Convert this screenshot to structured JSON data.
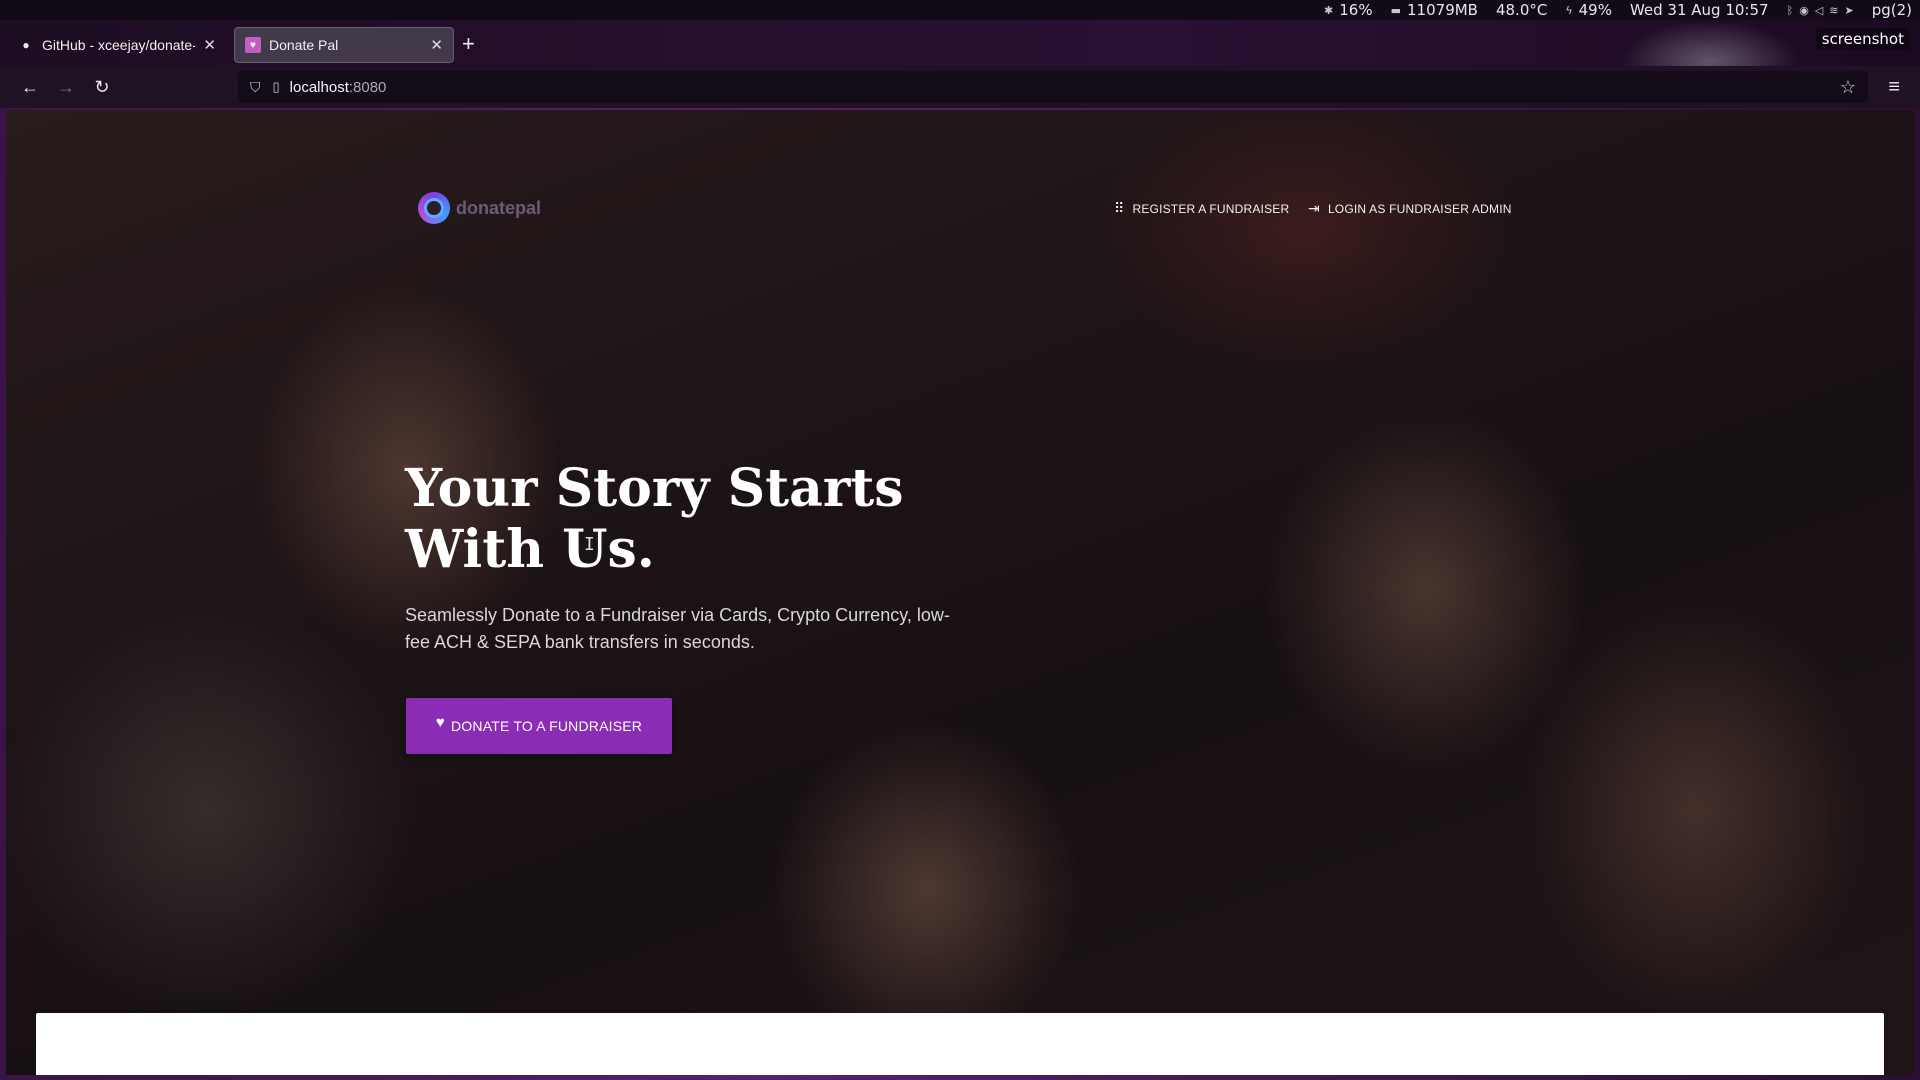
{
  "system": {
    "cpu": "16%",
    "memory": "11079MB",
    "temperature": "48.0°C",
    "battery": "49%",
    "datetime": "Wed 31 Aug 10:57",
    "workspace": "pg(2)"
  },
  "browser": {
    "tabs": [
      {
        "title": "GitHub - xceejay/donate-pa",
        "icon": "github-icon"
      },
      {
        "title": "Donate Pal",
        "icon": "donatepal-favicon"
      }
    ],
    "new_tab_label": "+",
    "screenshot_label": "screenshot",
    "url_host": "localhost",
    "url_port": ":8080"
  },
  "page": {
    "logo_text": "donatepal",
    "nav": {
      "register": "REGISTER A FUNDRAISER",
      "login": "LOGIN AS FUNDRAISER ADMIN"
    },
    "hero": {
      "title": "Your Story Starts With Us.",
      "subtitle": "Seamlessly Donate to a Fundraiser via Cards, Crypto Currency, low-fee ACH & SEPA bank transfers in seconds.",
      "cta": "DONATE TO A FUNDRAISER"
    },
    "colors": {
      "accent": "#8b2cb5",
      "hero_text": "#ffffff"
    }
  }
}
